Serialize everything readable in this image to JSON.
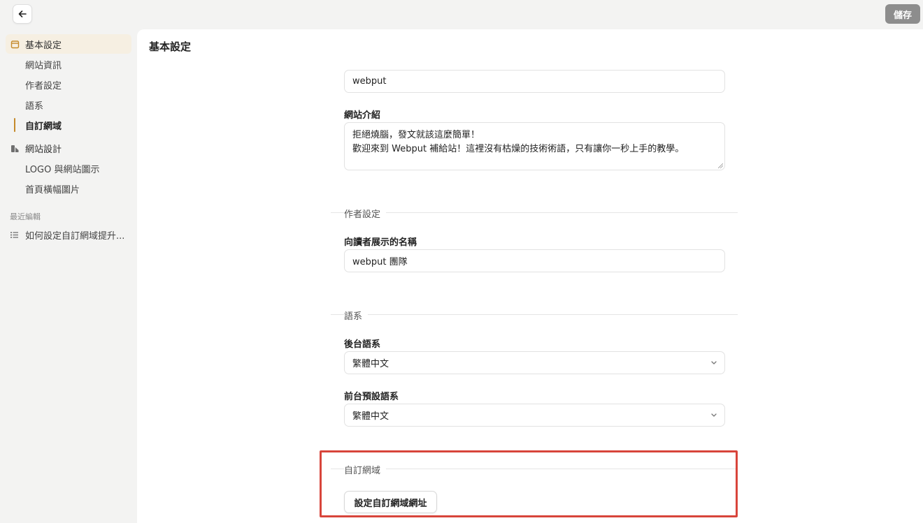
{
  "header": {
    "save_label": "儲存"
  },
  "sidebar": {
    "group_basic": {
      "label": "基本設定",
      "icon": "calendar-icon"
    },
    "basic_items": [
      {
        "label": "網站資訊"
      },
      {
        "label": "作者設定"
      },
      {
        "label": "語系"
      },
      {
        "label": "自訂網域"
      }
    ],
    "group_design": {
      "label": "網站設計",
      "icon": "design-icon"
    },
    "design_items": [
      {
        "label": "LOGO 與網站圖示"
      },
      {
        "label": "首頁橫幅圖片"
      }
    ],
    "recent_label": "最近編輯",
    "recent_items": [
      {
        "label": "如何設定自訂網域提升..."
      }
    ]
  },
  "main": {
    "title": "基本設定",
    "site_name_value": "webput",
    "site_intro_label": "網站介紹",
    "site_intro_line1": "拒絕燒腦，發文就該這麼簡單！",
    "site_intro_line2": "歡迎來到 Webput 補給站！這裡沒有枯燥的技術術語，只有讓你一秒上手的教學。",
    "author_section": "作者設定",
    "author_name_label": "向讀者展示的名稱",
    "author_name_value": "webput 團隊",
    "lang_section": "語系",
    "backend_lang_label": "後台語系",
    "backend_lang_value": "繁體中文",
    "frontend_lang_label": "前台預設語系",
    "frontend_lang_value": "繁體中文",
    "domain_section": "自訂網域",
    "domain_button": "設定自訂網域網址"
  },
  "colors": {
    "accent": "#c58a2b",
    "highlight": "#d8453b",
    "save_bg": "#8d8d8d"
  }
}
